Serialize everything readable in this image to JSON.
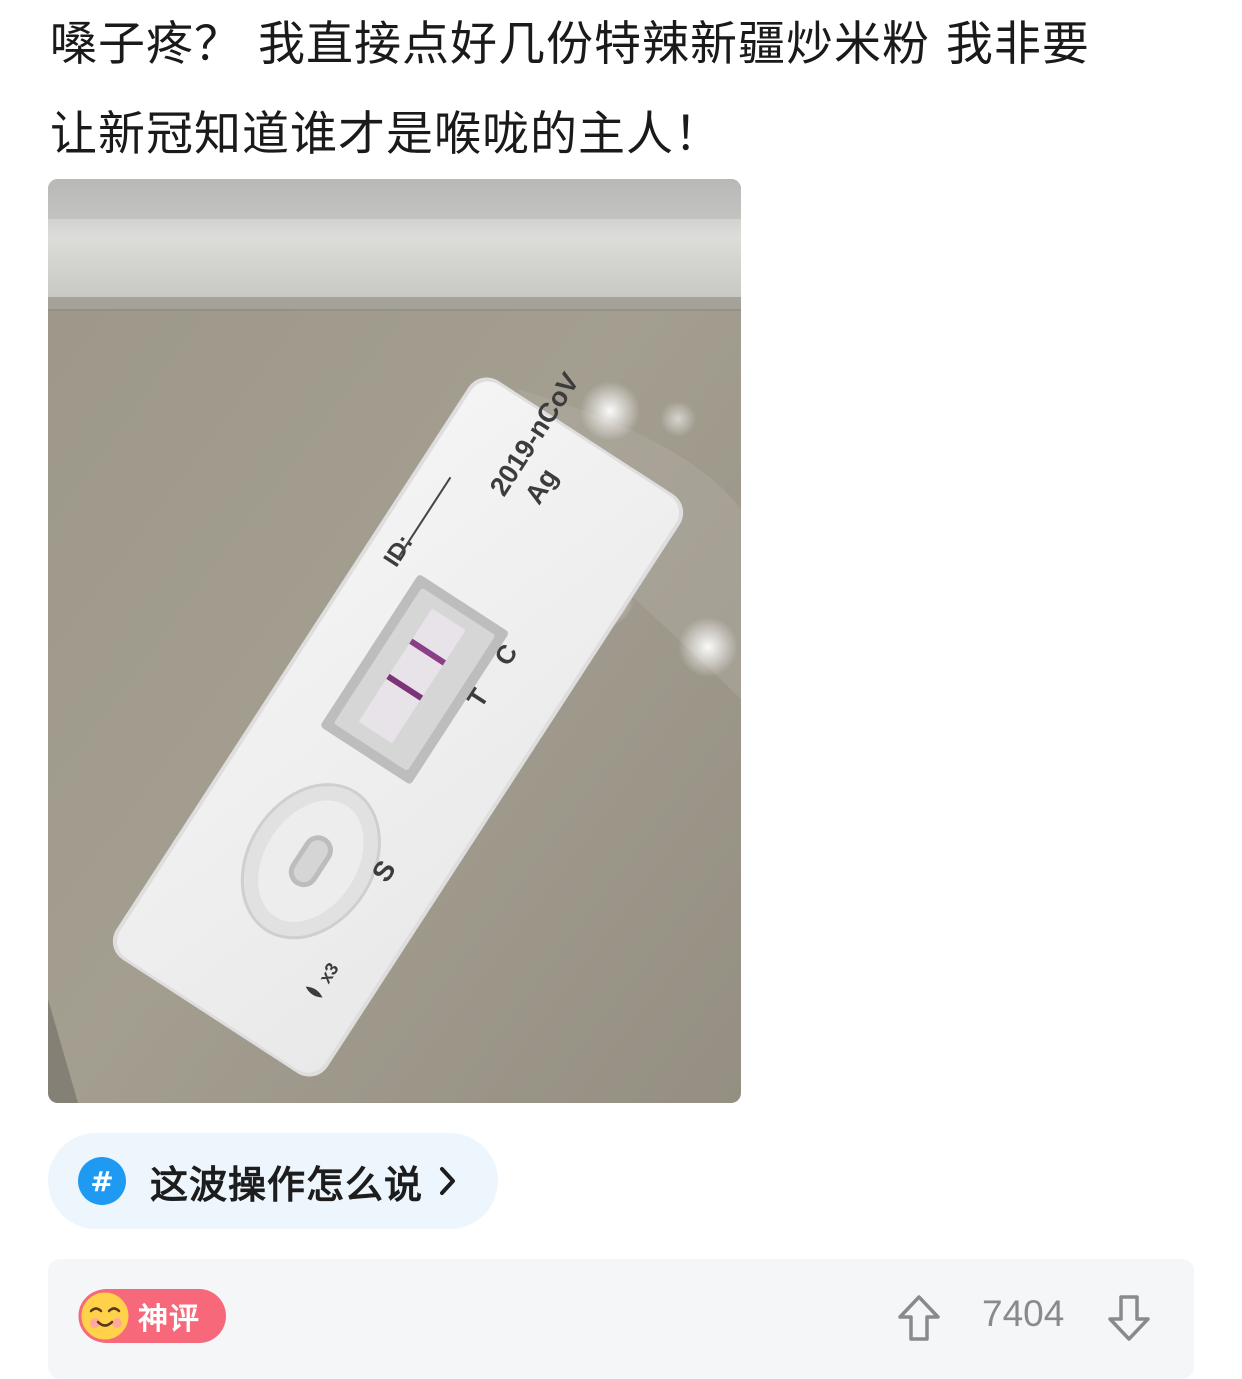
{
  "post": {
    "text_line1": "嗓子疼？ 我直接点好几份特辣新疆炒米粉 我非要",
    "text_line2": "让新冠知道谁才是喉咙的主人！"
  },
  "photo": {
    "title_line1": "2019-nCoV",
    "title_line2": "Ag",
    "id_label": "ID:",
    "control_label": "C",
    "test_label": "T",
    "sample_label": "S",
    "drops_label": "x3"
  },
  "topic": {
    "hash_symbol": "#",
    "label": "这波操作怎么说"
  },
  "comment": {
    "badge_label": "神评",
    "vote_count": "7404"
  },
  "colors": {
    "topic_bg": "#eef6fd",
    "hash_blue": "#1f9af2",
    "badge_pink": "#f7687b",
    "card_bg": "#f5f6f8",
    "count_gray": "#8a8a8a"
  },
  "icons": {
    "chevron": "chevron-right-icon",
    "upvote": "arrow-up-icon",
    "downvote": "arrow-down-icon",
    "emoji": "smiling-face-icon"
  }
}
